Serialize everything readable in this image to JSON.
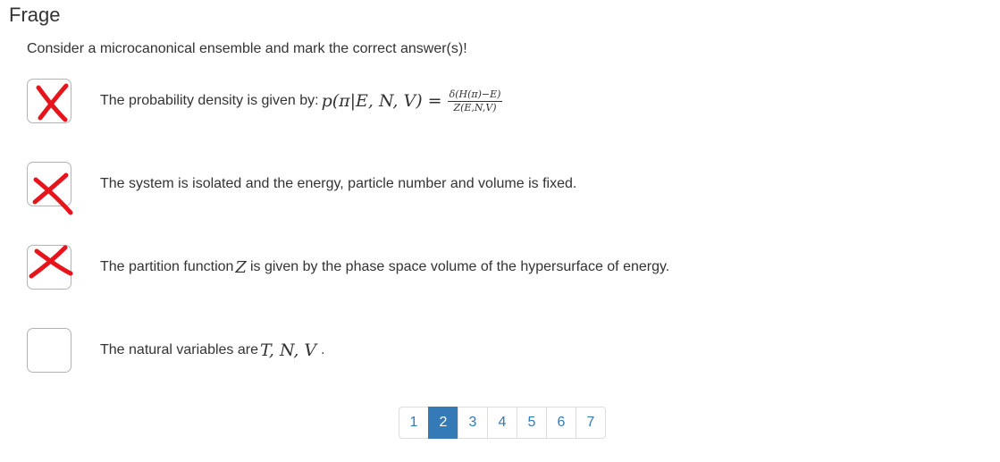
{
  "title": "Frage",
  "question": "Consider a microcanonical ensemble and mark the correct answer(s)!",
  "answers": [
    {
      "checked": true,
      "text_prefix": "The probability density is given by: ",
      "math_lhs": "p(π|E, N, V) =",
      "frac_num": "δ(H(π)−E)",
      "frac_den": "Z(E,N,V)"
    },
    {
      "checked": true,
      "text": "The system is isolated and the energy, particle number and volume is fixed."
    },
    {
      "checked": true,
      "text_prefix": "The partition function ",
      "math_var": "Z",
      "text_suffix": " is given by the phase space volume of the hypersurface of energy."
    },
    {
      "checked": false,
      "text_prefix": "The natural variables are ",
      "math_var": "T, N, V",
      "text_suffix": "."
    }
  ],
  "pagination": {
    "pages": [
      "1",
      "2",
      "3",
      "4",
      "5",
      "6",
      "7"
    ],
    "current": "2"
  },
  "colors": {
    "check_mark": "#e8141b",
    "link": "#337ab7",
    "active_page_bg": "#337ab7"
  },
  "icons": {
    "checked": "red-x-mark-icon"
  }
}
